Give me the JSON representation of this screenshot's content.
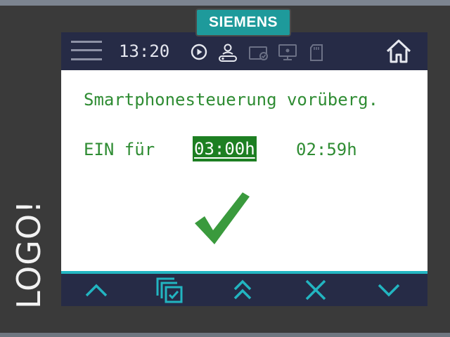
{
  "brand": "SIEMENS",
  "device_label": "LOGO!",
  "status_bar": {
    "time": "13:20",
    "icons": [
      "menu-icon",
      "play-circle-icon",
      "user-network-icon",
      "display-check-icon",
      "monitor-icon",
      "sd-card-icon",
      "home-icon"
    ]
  },
  "screen": {
    "heading": "Smartphonesteuerung vorüberg.",
    "ein_label": "EIN für",
    "time_set": "03:00h",
    "time_remaining": "02:59h",
    "confirm_icon": "check-icon"
  },
  "softkeys": [
    "chevron-up-icon",
    "copy-check-icon",
    "double-chevron-up-icon",
    "close-icon",
    "chevron-down-icon"
  ],
  "colors": {
    "frame": "#3a3a3a",
    "brand_teal": "#1e9a9b",
    "bar_navy": "#262b46",
    "accent_cyan": "#24b6c2",
    "text_green": "#2f8c33",
    "highlight_green": "#1d7f22"
  }
}
